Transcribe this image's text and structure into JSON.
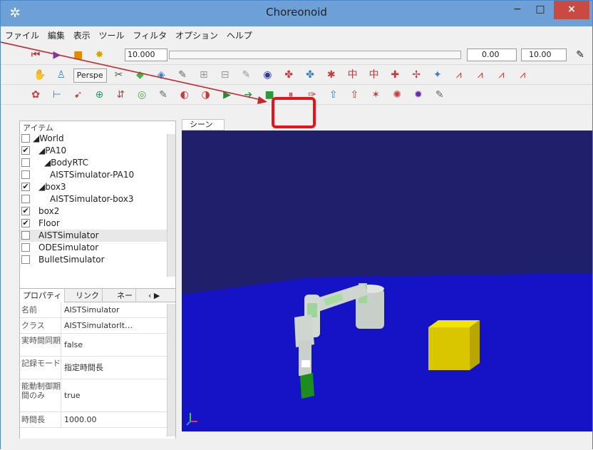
{
  "window": {
    "title": "Choreonoid",
    "minimize": "−",
    "maximize": "□",
    "close": "×"
  },
  "menu": [
    {
      "label": "ファイル"
    },
    {
      "label": "編集"
    },
    {
      "label": "表示"
    },
    {
      "label": "ツール"
    },
    {
      "label": "フィルタ"
    },
    {
      "label": "オプション"
    },
    {
      "label": "ヘルプ"
    }
  ],
  "toolbar1": {
    "time_value": "10.000",
    "range_start": "0.00",
    "range_end": "10.00"
  },
  "toolbar2": {
    "perspective_label": "Perspe"
  },
  "left_panel": {
    "items_tab": "アイテム",
    "tree": [
      {
        "label": "◢World",
        "checked": "",
        "indent": 0
      },
      {
        "label": "◢PA10",
        "checked": "✔",
        "indent": 1
      },
      {
        "label": "◢BodyRTC",
        "checked": "",
        "indent": 2
      },
      {
        "label": "AISTSimulator-PA10",
        "checked": "",
        "indent": 3
      },
      {
        "label": "◢box3",
        "checked": "✔",
        "indent": 1
      },
      {
        "label": "AISTSimulator-box3",
        "checked": "",
        "indent": 3
      },
      {
        "label": "box2",
        "checked": "✔",
        "indent": 1
      },
      {
        "label": "Floor",
        "checked": "✔",
        "indent": 1
      },
      {
        "label": "AISTSimulator",
        "checked": "",
        "indent": 1
      },
      {
        "label": "ODESimulator",
        "checked": "",
        "indent": 1
      },
      {
        "label": "BulletSimulator",
        "checked": "",
        "indent": 1
      }
    ],
    "property_tabs": [
      "プロパティ",
      "リンク",
      "ネー"
    ],
    "properties": [
      {
        "key": "名前",
        "value": "AISTSimulator"
      },
      {
        "key": "クラス",
        "value": "AISTSimulatorIt…"
      },
      {
        "key": "実時間同期",
        "value": "false"
      },
      {
        "key": "記録モード",
        "value": "指定時間長"
      },
      {
        "key": "能動制御期間のみ",
        "value": "true"
      },
      {
        "key": "時間長",
        "value": "1000.00"
      }
    ]
  },
  "scene": {
    "tab": "シーン"
  },
  "colors": {
    "accent": "#6ea0d8",
    "callout": "#e8131a",
    "scene_bg": "#1f1f6c",
    "floor": "#1414c6",
    "box": "#e5d200"
  }
}
